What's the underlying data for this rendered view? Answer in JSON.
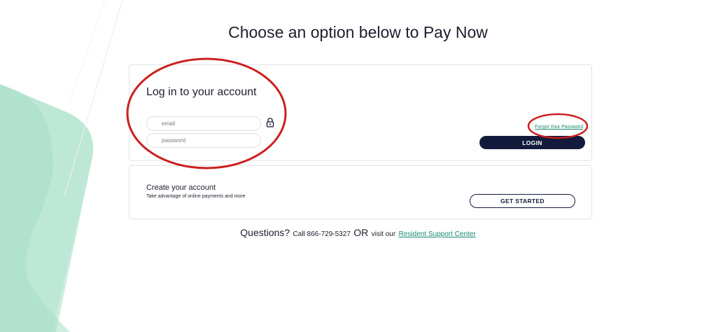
{
  "page": {
    "title": "Choose an option below to Pay Now"
  },
  "login": {
    "heading": "Log in to your account",
    "email_placeholder": "email",
    "password_placeholder": "password",
    "email_value": "",
    "password_value": "",
    "forgot_label": "Forgot Your Password",
    "login_button": "LOGIN",
    "lock_icon": "lock-icon"
  },
  "create": {
    "heading": "Create your account",
    "subtext": "Take advantage of online payments and more",
    "button": "GET STARTED"
  },
  "footer": {
    "questions": "Questions?",
    "call": "Call 866-729-5327",
    "or": "OR",
    "visit": "visit our",
    "link": "Resident Support Center"
  },
  "colors": {
    "navy": "#121b3c",
    "link_green": "#1a8a6e",
    "mint": "#a9e0cb",
    "annotation_red": "#cc1f1f"
  }
}
